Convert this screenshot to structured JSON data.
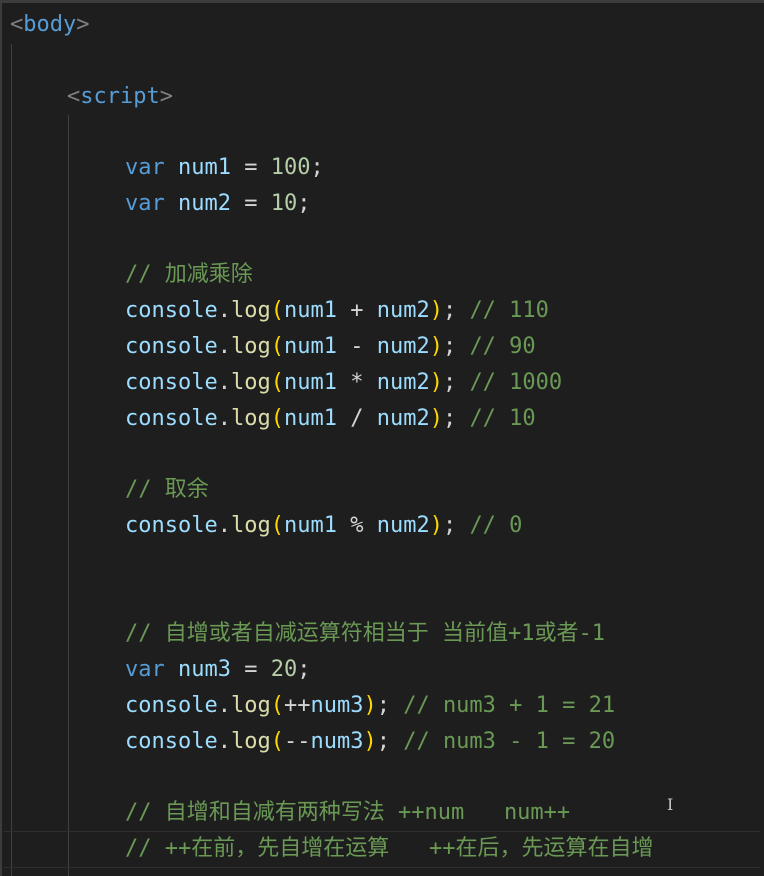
{
  "code": {
    "l1": {
      "lt": "<",
      "tag": "body",
      "gt": ">"
    },
    "l2": {
      "lt": "<",
      "tag": "script",
      "gt": ">"
    },
    "l3": {
      "kw": "var",
      "name": "num1",
      "eq": " = ",
      "val": "100",
      "semi": ";"
    },
    "l4": {
      "kw": "var",
      "name": "num2",
      "eq": " = ",
      "val": "10",
      "semi": ";"
    },
    "l5": {
      "comment": "// 加减乘除"
    },
    "l6": {
      "obj": "console",
      "dot": ".",
      "fn": "log",
      "open": "(",
      "a": "num1",
      "op": " + ",
      "b": "num2",
      "close": ")",
      "semi": "; ",
      "comment": "// 110"
    },
    "l7": {
      "obj": "console",
      "dot": ".",
      "fn": "log",
      "open": "(",
      "a": "num1",
      "op": " - ",
      "b": "num2",
      "close": ")",
      "semi": "; ",
      "comment": "// 90"
    },
    "l8": {
      "obj": "console",
      "dot": ".",
      "fn": "log",
      "open": "(",
      "a": "num1",
      "op": " * ",
      "b": "num2",
      "close": ")",
      "semi": "; ",
      "comment": "// 1000"
    },
    "l9": {
      "obj": "console",
      "dot": ".",
      "fn": "log",
      "open": "(",
      "a": "num1",
      "op": " / ",
      "b": "num2",
      "close": ")",
      "semi": "; ",
      "comment": "// 10"
    },
    "l10": {
      "comment": "// 取余"
    },
    "l11": {
      "obj": "console",
      "dot": ".",
      "fn": "log",
      "open": "(",
      "a": "num1",
      "op": " % ",
      "b": "num2",
      "close": ")",
      "semi": "; ",
      "comment": "// 0"
    },
    "l12": {
      "comment": "// 自增或者自减运算符相当于 当前值+1或者-1"
    },
    "l13": {
      "kw": "var",
      "name": "num3",
      "eq": " = ",
      "val": "20",
      "semi": ";"
    },
    "l14": {
      "obj": "console",
      "dot": ".",
      "fn": "log",
      "open": "(",
      "pre": "++",
      "a": "num3",
      "close": ")",
      "semi": "; ",
      "comment": "// num3 + 1 = 21"
    },
    "l15": {
      "obj": "console",
      "dot": ".",
      "fn": "log",
      "open": "(",
      "pre": "--",
      "a": "num3",
      "close": ")",
      "semi": "; ",
      "comment": "// num3 - 1 = 20"
    },
    "l16": {
      "comment": "// 自增和自减有两种写法 ++num   num++"
    },
    "l17": {
      "comment": "// ++在前，先自增在运算   ++在后，先运算在自增"
    }
  },
  "cursor_glyph": "I"
}
